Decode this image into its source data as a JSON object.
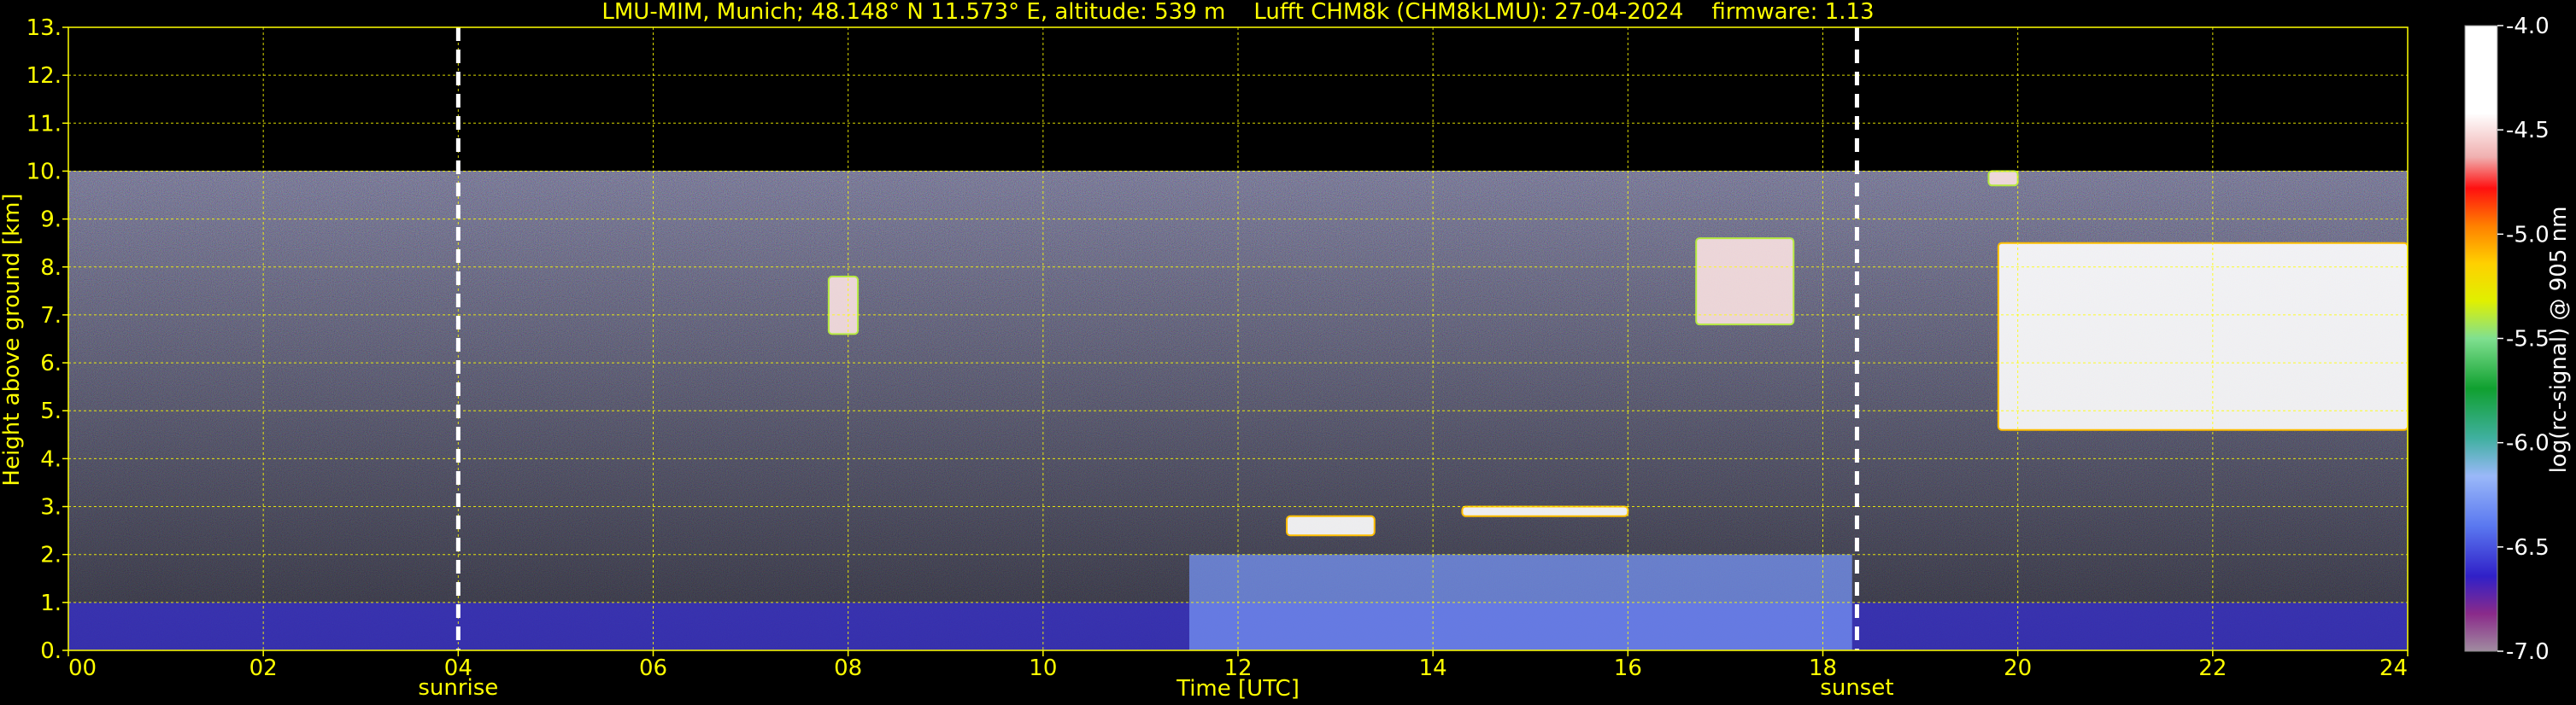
{
  "chart_data": {
    "type": "heatmap",
    "title": "LMU-MIM, Munich; 48.148° N 11.573° E, altitude: 539 m    Lufft CHM8k (CHM8kLMU): 27-04-2024    firmware: 1.13",
    "xlabel": "Time [UTC]",
    "ylabel": "Height above ground [km]",
    "xlim": [
      0,
      24
    ],
    "ylim": [
      0,
      13
    ],
    "x_ticks": [
      "00",
      "02",
      "04",
      "06",
      "08",
      "10",
      "12",
      "14",
      "16",
      "18",
      "20",
      "22",
      "24"
    ],
    "y_ticks": [
      "0.",
      "1.",
      "2.",
      "3.",
      "4.",
      "5.",
      "6.",
      "7.",
      "8.",
      "9.",
      "10.",
      "11.",
      "12.",
      "13."
    ],
    "grid": true,
    "data_ceiling_km": 10,
    "colorbar": {
      "label": "log(rc-signal) @ 905 nm",
      "range": [
        -7.0,
        -4.0
      ],
      "ticks": [
        "-4.0",
        "-4.5",
        "-5.0",
        "-5.5",
        "-6.0",
        "-6.5",
        "-7.0"
      ]
    },
    "markers": [
      {
        "label": "sunrise",
        "time": 4.0
      },
      {
        "label": "sunset",
        "time": 18.35
      }
    ],
    "layers": [
      {
        "name": "surface aerosol layer",
        "time_range": [
          0,
          24
        ],
        "height_km": [
          0,
          1.0
        ],
        "log_signal": -6.6
      },
      {
        "name": "boundary layer",
        "time_range": [
          11.5,
          18.3
        ],
        "height_km": [
          0,
          2.0
        ],
        "log_signal": -6.3
      }
    ],
    "cloud_segments": [
      {
        "time_range": [
          7.8,
          8.1
        ],
        "height_km": [
          6.6,
          7.8
        ],
        "log_signal": -4.5
      },
      {
        "time_range": [
          12.5,
          13.4
        ],
        "height_km": [
          2.4,
          2.8
        ],
        "log_signal": -4.2
      },
      {
        "time_range": [
          14.3,
          16.0
        ],
        "height_km": [
          2.8,
          3.0
        ],
        "log_signal": -4.2
      },
      {
        "time_range": [
          16.7,
          17.7
        ],
        "height_km": [
          6.8,
          8.6
        ],
        "log_signal": -4.5
      },
      {
        "time_range": [
          19.7,
          20.0
        ],
        "height_km": [
          9.7,
          10.0
        ],
        "log_signal": -4.5
      },
      {
        "time_range": [
          19.8,
          24.0
        ],
        "height_km": [
          4.6,
          8.5
        ],
        "log_signal": -4.2
      }
    ]
  },
  "colors": {
    "foreground": "#ffff00",
    "background": "#000000",
    "grid": "#ffff00",
    "colorbar_text": "#ffffff",
    "marker": "#ffffff"
  }
}
